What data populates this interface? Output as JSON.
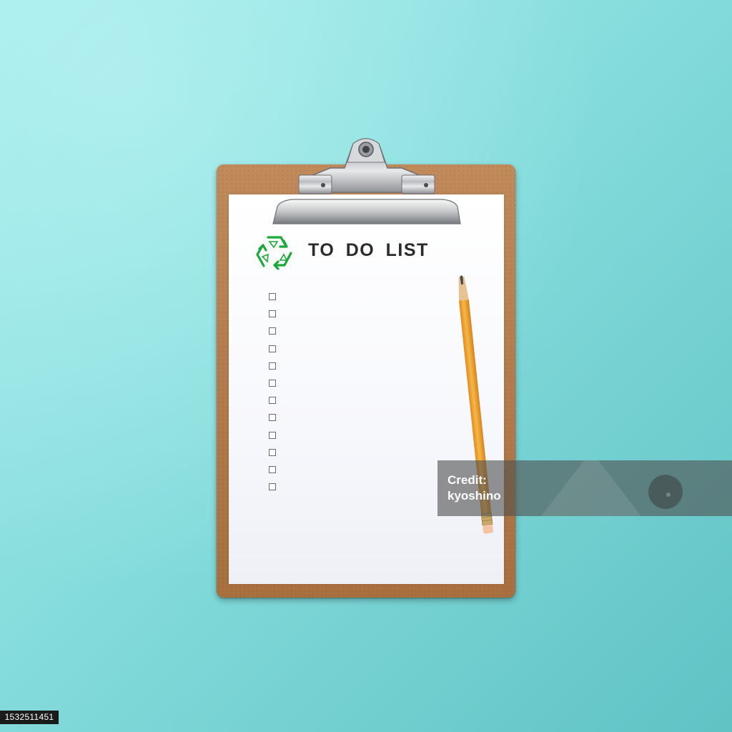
{
  "scene": {
    "background_color": "#8fdfe0",
    "board_color": "#b47c4c",
    "paper_color": "#fbfbfe"
  },
  "clipboard": {
    "title": "TO DO LIST",
    "logo_icon": "recycle-icon",
    "logo_color": "#1aa83a",
    "checkbox_count": 12
  },
  "pencil": {
    "color": "#f2a93b",
    "eraser_color": "#f4c3a6"
  },
  "watermark": {
    "line1": "Credit:",
    "line2": "Credit: kyoshino",
    "text_line1": "Credit:",
    "text_line2": "kyoshino"
  },
  "image_id": "1532511451"
}
